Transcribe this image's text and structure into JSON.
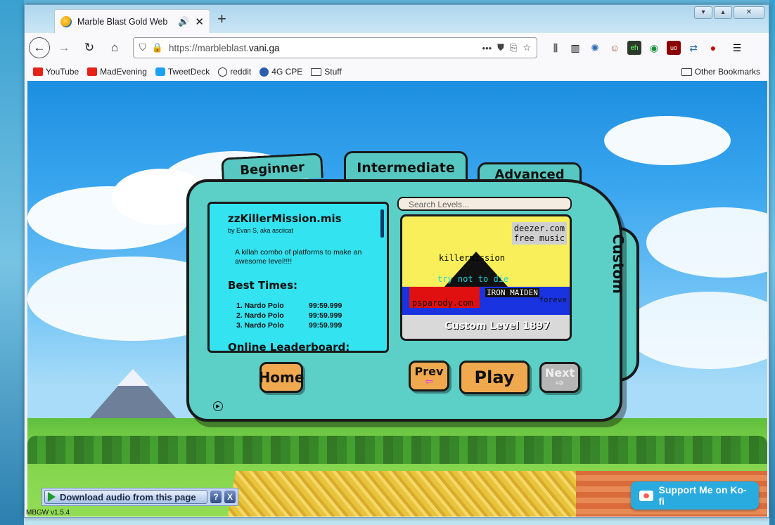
{
  "browser": {
    "tab_title": "Marble Blast Gold Web",
    "audio_icon": "speaker-icon",
    "close_glyph": "✕",
    "new_tab_glyph": "+",
    "url_prefix": "https://marbleblast.",
    "url_domain": "vani.ga",
    "window_controls": [
      "▾",
      "▴",
      "✕"
    ]
  },
  "bookmarks": [
    {
      "label": "YouTube",
      "icon": "youtube-icon"
    },
    {
      "label": "MadEvening",
      "icon": "youtube-icon"
    },
    {
      "label": "TweetDeck",
      "icon": "twitter-icon"
    },
    {
      "label": "reddit",
      "icon": "globe-icon"
    },
    {
      "label": "4G CPE",
      "icon": "router-icon"
    },
    {
      "label": "Stuff",
      "icon": "folder-icon"
    }
  ],
  "other_bookmarks": "Other Bookmarks",
  "game": {
    "tabs": [
      "Beginner",
      "Intermediate",
      "Advanced"
    ],
    "custom_tab": "Custom",
    "level": {
      "name": "zzKillerMission.mis",
      "author": "by Evan S, aka asciicat",
      "description": "A killah combo of platforms to make an awesome level!!!!",
      "best_times_heading": "Best Times:",
      "times": [
        {
          "name": "1. Nardo Polo",
          "time": "99:59.999"
        },
        {
          "name": "2. Nardo Polo",
          "time": "99:59.999"
        },
        {
          "name": "3. Nardo Polo",
          "time": "99:59.999"
        }
      ],
      "leaderboard_heading": "Online Leaderboard:"
    },
    "search_placeholder": "Search Levels...",
    "preview": {
      "ad_line1": "deezer.com",
      "ad_line2": "free music",
      "text_killermission": "killermission",
      "text_trynottodie": "try not to die",
      "text_ironmaiden": "IRON MAIDEN",
      "text_psparody": "psparody.com",
      "text_forever": "foreve",
      "caption": "Custom Level 1897"
    },
    "buttons": {
      "home": "Home",
      "prev": "Prev",
      "play": "Play",
      "next": "Next"
    }
  },
  "overlays": {
    "download_label": "Download audio from this page",
    "help_glyph": "?",
    "close_glyph": "X",
    "version": "MBGW v1.5.4",
    "kofi_label": "Support Me on Ko-fi"
  }
}
